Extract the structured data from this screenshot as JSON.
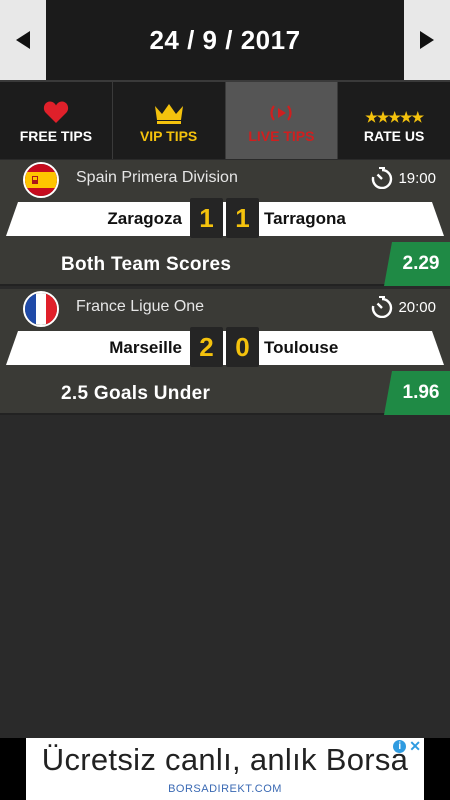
{
  "header": {
    "date": "24 / 9 / 2017",
    "prev_icon": "triangle-left-icon",
    "next_icon": "triangle-right-icon"
  },
  "tabs": [
    {
      "label": "FREE TIPS",
      "icon": "heart-icon",
      "active": false,
      "color": "#ffffff"
    },
    {
      "label": "VIP TIPS",
      "icon": "crown-icon",
      "active": false,
      "color": "#f4c20d"
    },
    {
      "label": "LIVE TIPS",
      "icon": "live-broadcast-icon",
      "active": true,
      "color": "#cf1f1f"
    },
    {
      "label": "RATE US",
      "icon": "stars-icon",
      "stars": "★★★★★",
      "active": false,
      "color": "#ffffff"
    }
  ],
  "matches": [
    {
      "league": "Spain Primera Division",
      "flag": "spain-flag",
      "time": "19:00",
      "home": "Zaragoza",
      "away": "Tarragona",
      "home_score": "1",
      "away_score": "1",
      "tip": "Both Team Scores",
      "odds": "2.29"
    },
    {
      "league": "France Ligue One",
      "flag": "france-flag",
      "time": "20:00",
      "home": "Marseille",
      "away": "Toulouse",
      "home_score": "2",
      "away_score": "0",
      "tip": "2.5 Goals Under",
      "odds": "1.96"
    }
  ],
  "ad": {
    "text": "Ücretsiz canlı, anlık Borsa",
    "brand": "BORSADIREKT.COM",
    "info_label": "i",
    "close_label": "✕"
  },
  "colors": {
    "accent_gold": "#f4c20d",
    "live_red": "#cf1f1f",
    "odds_green": "#1f8a45"
  }
}
